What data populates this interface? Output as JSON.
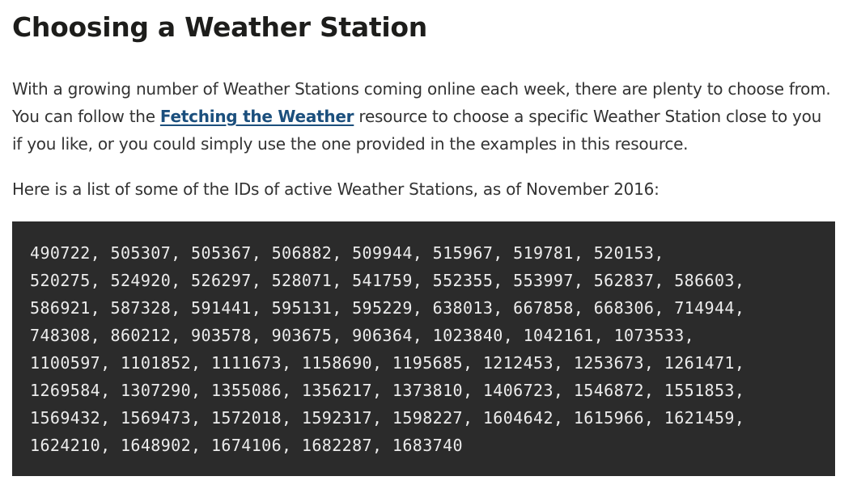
{
  "article": {
    "heading": "Choosing a Weather Station",
    "intro": {
      "before_link": "With a growing number of Weather Stations coming online each week, there are plenty to choose from. You can follow the ",
      "link_text": "Fetching the Weather",
      "after_link": " resource to choose a specific Weather Station close to you if you like, or you could simply use the one provided in the examples in this resource."
    },
    "list_intro": "Here is a list of some of the IDs of active Weather Stations, as of November 2016:",
    "station_ids": {
      "lines": [
        "490722, 505307, 505367, 506882, 509944, 515967, 519781, 520153,",
        "520275, 524920, 526297, 528071, 541759, 552355, 553997, 562837, 586603,",
        "586921, 587328, 591441, 595131, 595229, 638013, 667858, 668306, 714944,",
        "748308, 860212, 903578, 903675, 906364, 1023840, 1042161, 1073533,",
        "1100597, 1101852, 1111673, 1158690, 1195685, 1212453, 1253673, 1261471,",
        "1269584, 1307290, 1355086, 1356217, 1373810, 1406723, 1546872, 1551853,",
        "1569432, 1569473, 1572018, 1592317, 1598227, 1604642, 1615966, 1621459,",
        "1624210, 1648902, 1674106, 1682287, 1683740"
      ]
    }
  },
  "colors": {
    "heading": "#1d1d1b",
    "body_text": "#333333",
    "link": "#1b4f7d",
    "code_background": "#2b2b2b",
    "code_text": "#ececec"
  }
}
